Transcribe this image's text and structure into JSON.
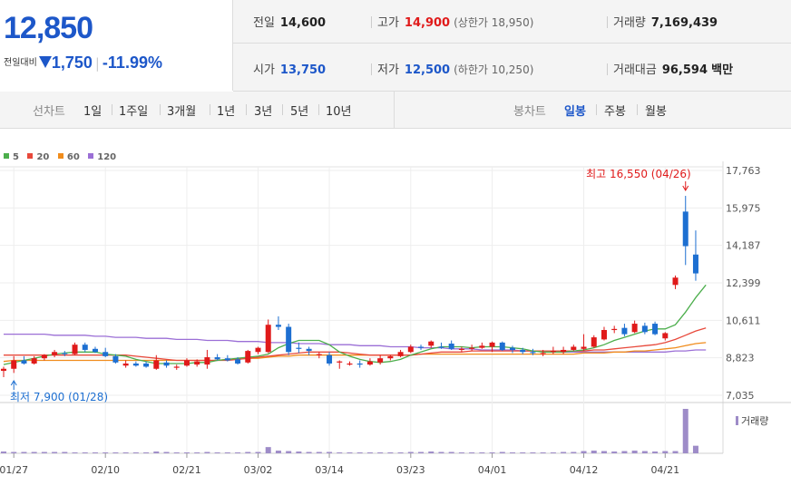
{
  "quote": {
    "price": "12,850",
    "change_label": "전일대비",
    "change_value": "1,750",
    "change_pct": "-11.99%",
    "prev_label": "전일",
    "prev_value": "14,600",
    "high_label": "고가",
    "high_value": "14,900",
    "upper_limit_text": "(상한가 18,950)",
    "volume_label": "거래량",
    "volume_value": "7,169,439",
    "open_label": "시가",
    "open_value": "13,750",
    "low_label": "저가",
    "low_value": "12,500",
    "lower_limit_text": "(하한가 10,250)",
    "amount_label": "거래대금",
    "amount_value": "96,594",
    "amount_unit": "백만"
  },
  "toolbar": {
    "line_chart_label": "선차트",
    "periods": [
      "1일",
      "1주일",
      "3개월",
      "1년",
      "3년",
      "5년",
      "10년"
    ],
    "candle_chart_label": "봉차트",
    "candle_types": [
      "일봉",
      "주봉",
      "월봉"
    ],
    "active_candle": "일봉"
  },
  "colors": {
    "up": "#e01a1a",
    "down": "#1d6fd1",
    "ma5": "#4cae4c",
    "ma20": "#e8493b",
    "ma60": "#f08c1c",
    "ma120": "#9b6fd6",
    "volume": "#9e8cc8"
  },
  "chart_data": {
    "type": "candlestick",
    "title": "",
    "legend": [
      {
        "name": "5",
        "color": "#4cae4c"
      },
      {
        "name": "20",
        "color": "#e8493b"
      },
      {
        "name": "60",
        "color": "#f08c1c"
      },
      {
        "name": "120",
        "color": "#9b6fd6"
      }
    ],
    "y_ticks": [
      "17,763",
      "15,975",
      "14,187",
      "12,399",
      "10,611",
      "8,823",
      "7,035"
    ],
    "ylim": [
      7035,
      17763
    ],
    "x_ticks": [
      "01/27",
      "02/10",
      "02/21",
      "03/02",
      "03/14",
      "03/23",
      "04/01",
      "04/12",
      "04/21"
    ],
    "max_annotation": "최고 16,550 (04/26)",
    "min_annotation": "최저 7,900 (01/28)",
    "volume_label": "거래량",
    "candles": [
      {
        "o": 8200,
        "h": 8400,
        "l": 7900,
        "c": 8300
      },
      {
        "o": 8300,
        "h": 8900,
        "l": 8100,
        "c": 8700
      },
      {
        "o": 8700,
        "h": 8900,
        "l": 8500,
        "c": 8550
      },
      {
        "o": 8550,
        "h": 8900,
        "l": 8500,
        "c": 8800
      },
      {
        "o": 8800,
        "h": 9000,
        "l": 8700,
        "c": 8950
      },
      {
        "o": 8950,
        "h": 9200,
        "l": 8850,
        "c": 9100
      },
      {
        "o": 9050,
        "h": 9150,
        "l": 8900,
        "c": 9000
      },
      {
        "o": 9000,
        "h": 9550,
        "l": 8950,
        "c": 9450
      },
      {
        "o": 9450,
        "h": 9550,
        "l": 9100,
        "c": 9200
      },
      {
        "o": 9250,
        "h": 9350,
        "l": 9050,
        "c": 9100
      },
      {
        "o": 9100,
        "h": 9300,
        "l": 8850,
        "c": 8900
      },
      {
        "o": 8900,
        "h": 9000,
        "l": 8550,
        "c": 8600
      },
      {
        "o": 8450,
        "h": 8700,
        "l": 8350,
        "c": 8550
      },
      {
        "o": 8550,
        "h": 8650,
        "l": 8400,
        "c": 8450
      },
      {
        "o": 8550,
        "h": 8650,
        "l": 8350,
        "c": 8400
      },
      {
        "o": 8300,
        "h": 8950,
        "l": 8250,
        "c": 8700
      },
      {
        "o": 8600,
        "h": 8700,
        "l": 8350,
        "c": 8450
      },
      {
        "o": 8350,
        "h": 8500,
        "l": 8250,
        "c": 8400
      },
      {
        "o": 8450,
        "h": 8800,
        "l": 8400,
        "c": 8700
      },
      {
        "o": 8500,
        "h": 8750,
        "l": 8400,
        "c": 8650
      },
      {
        "o": 8500,
        "h": 9200,
        "l": 8300,
        "c": 8850
      },
      {
        "o": 8850,
        "h": 9000,
        "l": 8700,
        "c": 8750
      },
      {
        "o": 8800,
        "h": 8950,
        "l": 8650,
        "c": 8700
      },
      {
        "o": 8750,
        "h": 8850,
        "l": 8500,
        "c": 8550
      },
      {
        "o": 8600,
        "h": 9200,
        "l": 8550,
        "c": 9150
      },
      {
        "o": 9100,
        "h": 9350,
        "l": 9000,
        "c": 9300
      },
      {
        "o": 9100,
        "h": 10650,
        "l": 9050,
        "c": 10400
      },
      {
        "o": 10400,
        "h": 10800,
        "l": 10150,
        "c": 10300
      },
      {
        "o": 10300,
        "h": 10450,
        "l": 8950,
        "c": 9100
      },
      {
        "o": 9300,
        "h": 9550,
        "l": 9050,
        "c": 9250
      },
      {
        "o": 9250,
        "h": 9350,
        "l": 8950,
        "c": 9150
      },
      {
        "o": 8950,
        "h": 9100,
        "l": 8800,
        "c": 9000
      },
      {
        "o": 8950,
        "h": 9100,
        "l": 8450,
        "c": 8550
      },
      {
        "o": 8600,
        "h": 8700,
        "l": 8300,
        "c": 8650
      },
      {
        "o": 8500,
        "h": 8650,
        "l": 8450,
        "c": 8550
      },
      {
        "o": 8550,
        "h": 8700,
        "l": 8350,
        "c": 8500
      },
      {
        "o": 8500,
        "h": 8800,
        "l": 8450,
        "c": 8650
      },
      {
        "o": 8600,
        "h": 8950,
        "l": 8500,
        "c": 8800
      },
      {
        "o": 8800,
        "h": 8950,
        "l": 8700,
        "c": 8900
      },
      {
        "o": 8900,
        "h": 9200,
        "l": 8850,
        "c": 9100
      },
      {
        "o": 9100,
        "h": 9450,
        "l": 9050,
        "c": 9350
      },
      {
        "o": 9350,
        "h": 9450,
        "l": 9200,
        "c": 9300
      },
      {
        "o": 9400,
        "h": 9650,
        "l": 9300,
        "c": 9600
      },
      {
        "o": 9350,
        "h": 9550,
        "l": 9250,
        "c": 9300
      },
      {
        "o": 9500,
        "h": 9650,
        "l": 9200,
        "c": 9250
      },
      {
        "o": 9200,
        "h": 9350,
        "l": 9100,
        "c": 9250
      },
      {
        "o": 9250,
        "h": 9450,
        "l": 9150,
        "c": 9300
      },
      {
        "o": 9300,
        "h": 9550,
        "l": 9250,
        "c": 9400
      },
      {
        "o": 9350,
        "h": 9600,
        "l": 9100,
        "c": 9550
      },
      {
        "o": 9550,
        "h": 9600,
        "l": 9150,
        "c": 9200
      },
      {
        "o": 9300,
        "h": 9400,
        "l": 9050,
        "c": 9200
      },
      {
        "o": 9200,
        "h": 9300,
        "l": 9000,
        "c": 9100
      },
      {
        "o": 9100,
        "h": 9250,
        "l": 8950,
        "c": 9050
      },
      {
        "o": 9050,
        "h": 9200,
        "l": 8900,
        "c": 9050
      },
      {
        "o": 9100,
        "h": 9350,
        "l": 9000,
        "c": 9150
      },
      {
        "o": 9100,
        "h": 9350,
        "l": 9000,
        "c": 9200
      },
      {
        "o": 9200,
        "h": 9450,
        "l": 9150,
        "c": 9350
      },
      {
        "o": 9250,
        "h": 9950,
        "l": 9150,
        "c": 9350
      },
      {
        "o": 9350,
        "h": 9900,
        "l": 9300,
        "c": 9800
      },
      {
        "o": 9700,
        "h": 10300,
        "l": 9650,
        "c": 10150
      },
      {
        "o": 10150,
        "h": 10350,
        "l": 10000,
        "c": 10200
      },
      {
        "o": 10250,
        "h": 10450,
        "l": 9850,
        "c": 9950
      },
      {
        "o": 10050,
        "h": 10600,
        "l": 10000,
        "c": 10450
      },
      {
        "o": 10350,
        "h": 10500,
        "l": 9950,
        "c": 10050
      },
      {
        "o": 10450,
        "h": 10550,
        "l": 9900,
        "c": 9950
      },
      {
        "o": 9750,
        "h": 10050,
        "l": 9650,
        "c": 10000
      },
      {
        "o": 12300,
        "h": 12750,
        "l": 12100,
        "c": 12650
      },
      {
        "o": 15800,
        "h": 16550,
        "l": 13250,
        "c": 14150
      },
      {
        "o": 13750,
        "h": 14900,
        "l": 12500,
        "c": 12850
      }
    ],
    "ma5": [
      8500,
      8600,
      8700,
      8800,
      8900,
      9000,
      9050,
      9100,
      9100,
      9100,
      9000,
      8950,
      8900,
      8750,
      8650,
      8550,
      8550,
      8550,
      8550,
      8600,
      8600,
      8700,
      8750,
      8800,
      8850,
      8900,
      9000,
      9300,
      9500,
      9650,
      9650,
      9650,
      9450,
      9100,
      8900,
      8750,
      8650,
      8600,
      8650,
      8750,
      8950,
      9100,
      9250,
      9350,
      9350,
      9350,
      9300,
      9350,
      9350,
      9350,
      9300,
      9250,
      9150,
      9100,
      9100,
      9100,
      9150,
      9200,
      9300,
      9450,
      9650,
      9800,
      9950,
      10100,
      10200,
      10200,
      10400,
      11000,
      11700,
      12300
    ],
    "ma20": [
      8950,
      8950,
      8950,
      8950,
      8950,
      8950,
      8950,
      8950,
      8950,
      8950,
      8950,
      8950,
      8950,
      8900,
      8850,
      8800,
      8750,
      8700,
      8700,
      8700,
      8700,
      8700,
      8700,
      8750,
      8800,
      8850,
      8900,
      8950,
      9000,
      9050,
      9100,
      9100,
      9100,
      9100,
      9050,
      9000,
      8950,
      8950,
      8950,
      8950,
      8950,
      9000,
      9050,
      9100,
      9100,
      9100,
      9150,
      9150,
      9150,
      9150,
      9150,
      9150,
      9150,
      9150,
      9150,
      9150,
      9150,
      9150,
      9200,
      9200,
      9250,
      9300,
      9350,
      9400,
      9450,
      9550,
      9700,
      9900,
      10100,
      10250
    ],
    "ma60": [
      8650,
      8700,
      8700,
      8700,
      8700,
      8700,
      8700,
      8700,
      8700,
      8700,
      8700,
      8700,
      8700,
      8700,
      8700,
      8700,
      8700,
      8700,
      8700,
      8700,
      8700,
      8700,
      8750,
      8750,
      8800,
      8800,
      8850,
      8900,
      8900,
      8950,
      8950,
      8950,
      8950,
      8950,
      8950,
      8950,
      8950,
      8950,
      8950,
      8950,
      8950,
      9000,
      9000,
      9000,
      9000,
      9000,
      9000,
      9000,
      9000,
      9000,
      9000,
      9000,
      9000,
      9000,
      9000,
      9000,
      9000,
      9050,
      9050,
      9050,
      9100,
      9100,
      9150,
      9150,
      9200,
      9250,
      9300,
      9400,
      9500,
      9550
    ],
    "ma120": [
      9950,
      9950,
      9950,
      9950,
      9950,
      9900,
      9900,
      9900,
      9900,
      9850,
      9850,
      9800,
      9800,
      9800,
      9750,
      9750,
      9750,
      9700,
      9700,
      9700,
      9650,
      9650,
      9650,
      9600,
      9600,
      9600,
      9550,
      9550,
      9550,
      9500,
      9500,
      9500,
      9450,
      9450,
      9450,
      9400,
      9400,
      9400,
      9350,
      9350,
      9350,
      9300,
      9300,
      9300,
      9250,
      9250,
      9250,
      9200,
      9200,
      9200,
      9200,
      9150,
      9150,
      9150,
      9150,
      9100,
      9100,
      9100,
      9100,
      9100,
      9100,
      9100,
      9100,
      9100,
      9100,
      9100,
      9150,
      9150,
      9200,
      9200
    ],
    "volume": [
      4,
      3,
      3,
      3,
      3,
      3,
      3,
      2,
      2,
      2,
      2,
      2,
      2,
      2,
      2,
      4,
      3,
      2,
      2,
      2,
      3,
      2,
      2,
      2,
      3,
      3,
      14,
      6,
      5,
      4,
      3,
      3,
      3,
      2,
      2,
      2,
      2,
      2,
      2,
      2,
      3,
      3,
      4,
      3,
      3,
      2,
      2,
      2,
      2,
      3,
      2,
      2,
      2,
      2,
      2,
      3,
      3,
      5,
      6,
      5,
      4,
      5,
      6,
      5,
      4,
      5,
      5,
      100,
      17
    ]
  }
}
